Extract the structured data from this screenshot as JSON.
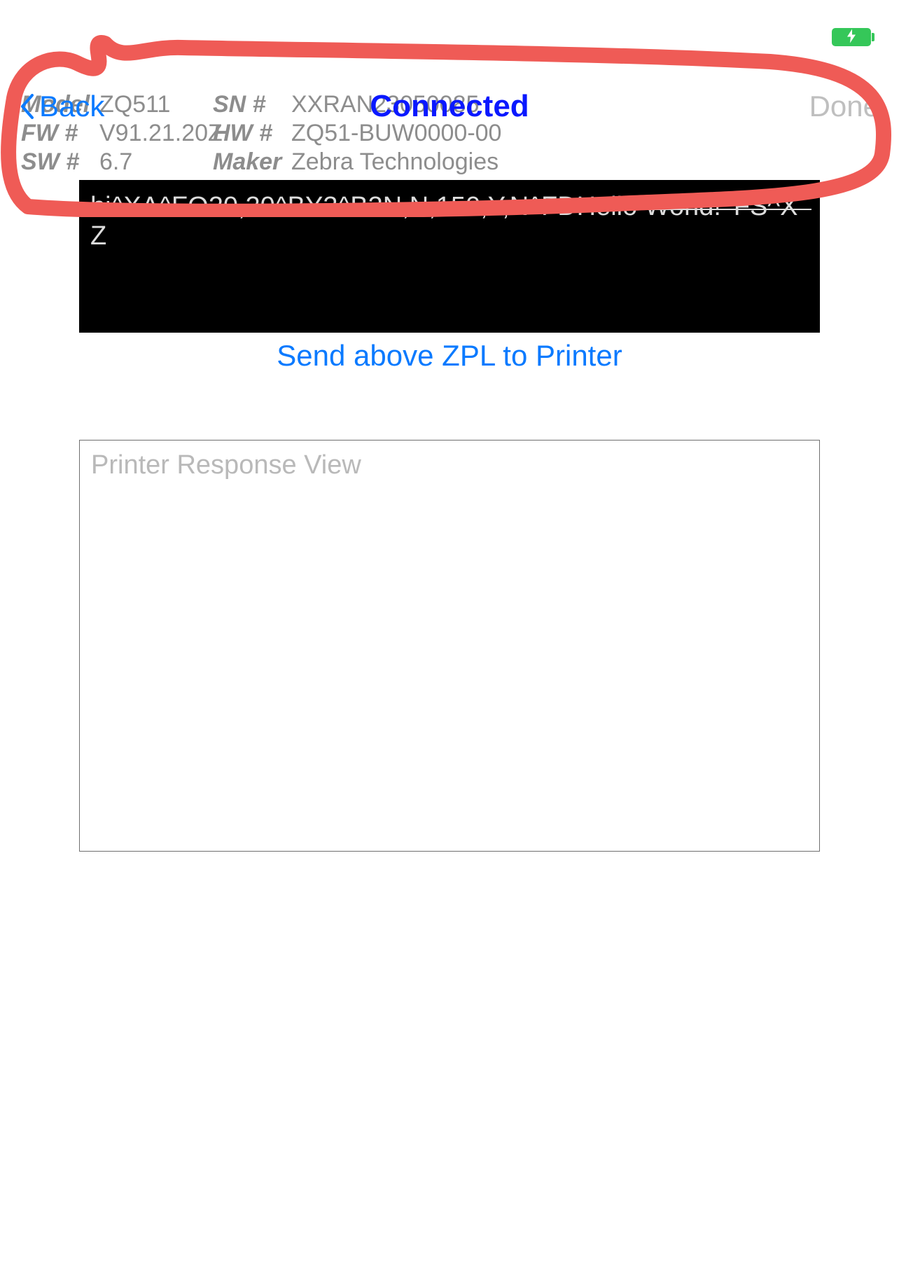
{
  "status_bar": {
    "battery_icon": "battery-charging-icon"
  },
  "nav": {
    "back_label": "Back",
    "title": "Connected",
    "done_label": "Done"
  },
  "printer": {
    "model_label": "Model",
    "model": "ZQ511",
    "sn_label": "SN #",
    "sn": "XXRAN23050085",
    "fw_label": "FW #",
    "fw": "V91.21.20Z",
    "hw_label": "HW #",
    "hw": "ZQ51-BUW0000-00",
    "sw_label": "SW #",
    "sw": "6.7",
    "maker_label": "Maker",
    "maker": "Zebra Technologies"
  },
  "zpl": {
    "content": "hi^XA^FO20,20^BY3^B3N,N,150,Y,N^FDHello World!^FS^XZ"
  },
  "actions": {
    "send_label": "Send above ZPL to Printer"
  },
  "response": {
    "placeholder": "Printer Response View",
    "value": ""
  },
  "colors": {
    "ios_blue": "#0a7aff",
    "title_blue": "#0a18ff",
    "disabled_gray": "#bfbfbf",
    "meta_gray": "#8d8d8d",
    "battery_green": "#35c759",
    "annotation_red": "#ef5b56"
  }
}
